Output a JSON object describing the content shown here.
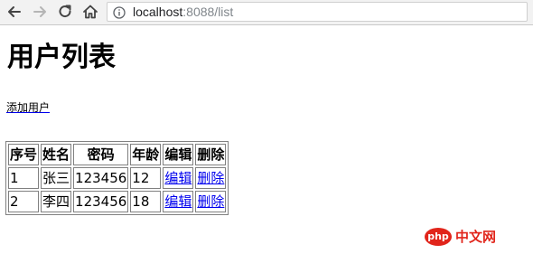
{
  "browser": {
    "url_host": "localhost",
    "url_rest": ":8088/list"
  },
  "page": {
    "title": "用户列表",
    "add_user_link": "添加用户"
  },
  "table": {
    "headers": [
      "序号",
      "姓名",
      "密码",
      "年龄",
      "编辑",
      "删除"
    ],
    "rows": [
      {
        "id": "1",
        "name": "张三",
        "password": "123456",
        "age": "12",
        "edit": "编辑",
        "delete": "删除"
      },
      {
        "id": "2",
        "name": "李四",
        "password": "123456",
        "age": "18",
        "edit": "编辑",
        "delete": "删除"
      }
    ]
  },
  "watermark": {
    "badge": "php",
    "text": "中文网"
  },
  "colors": {
    "link": "#0000ee",
    "toolbar": "#f2f2f2",
    "watermark": "#e1251b"
  }
}
